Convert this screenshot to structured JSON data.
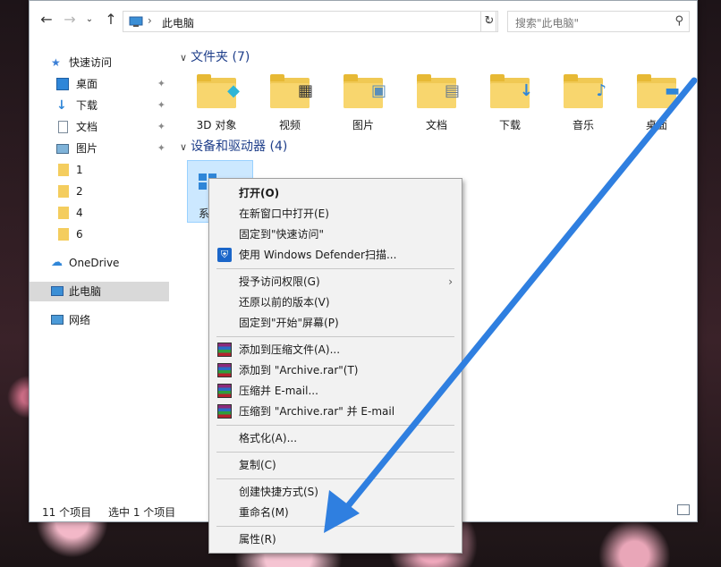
{
  "address": {
    "path": "此电脑",
    "search_placeholder": "搜索\"此电脑\""
  },
  "sidebar": {
    "items": [
      {
        "label": "快速访问",
        "icon": "star-icon",
        "pinned": false
      },
      {
        "label": "桌面",
        "icon": "desktop-icon",
        "pinned": true
      },
      {
        "label": "下载",
        "icon": "download-icon",
        "pinned": true
      },
      {
        "label": "文档",
        "icon": "document-icon",
        "pinned": true
      },
      {
        "label": "图片",
        "icon": "picture-icon",
        "pinned": true
      },
      {
        "label": "1",
        "icon": "folder-icon",
        "pinned": false
      },
      {
        "label": "2",
        "icon": "folder-icon",
        "pinned": false
      },
      {
        "label": "4",
        "icon": "folder-icon",
        "pinned": false
      },
      {
        "label": "6",
        "icon": "folder-icon",
        "pinned": false
      },
      {
        "label": "OneDrive",
        "icon": "cloud-icon",
        "pinned": false
      },
      {
        "label": "此电脑",
        "icon": "computer-icon",
        "pinned": false,
        "selected": true
      },
      {
        "label": "网络",
        "icon": "network-icon",
        "pinned": false
      }
    ]
  },
  "main": {
    "folders_header": "文件夹 (7)",
    "folders": [
      {
        "label": "3D 对象",
        "icon": "3d-objects-icon"
      },
      {
        "label": "视频",
        "icon": "video-icon"
      },
      {
        "label": "图片",
        "icon": "picture-icon"
      },
      {
        "label": "文档",
        "icon": "document-icon"
      },
      {
        "label": "下载",
        "icon": "download-icon"
      },
      {
        "label": "音乐",
        "icon": "music-icon"
      },
      {
        "label": "桌面",
        "icon": "desktop-icon"
      }
    ],
    "devices_header": "设备和驱动器 (4)",
    "drive_label": "系"
  },
  "status": {
    "count": "11 个项目",
    "selected": "选中 1 个项目"
  },
  "context_menu": {
    "items": [
      {
        "label": "打开(O)",
        "bold": true
      },
      {
        "label": "在新窗口中打开(E)"
      },
      {
        "label": "固定到\"快速访问\""
      },
      {
        "label": "使用 Windows Defender扫描...",
        "icon": "defender-shield-icon"
      },
      {
        "label": "授予访问权限(G)",
        "submenu": true
      },
      {
        "label": "还原以前的版本(V)"
      },
      {
        "label": "固定到\"开始\"屏幕(P)"
      },
      {
        "label": "添加到压缩文件(A)...",
        "icon": "winrar-icon"
      },
      {
        "label": "添加到 \"Archive.rar\"(T)",
        "icon": "winrar-icon"
      },
      {
        "label": "压缩并 E-mail...",
        "icon": "winrar-icon"
      },
      {
        "label": "压缩到 \"Archive.rar\" 并 E-mail",
        "icon": "winrar-icon"
      },
      {
        "label": "格式化(A)..."
      },
      {
        "label": "复制(C)"
      },
      {
        "label": "创建快捷方式(S)"
      },
      {
        "label": "重命名(M)"
      },
      {
        "label": "属性(R)"
      }
    ]
  },
  "colors": {
    "accent_arrow": "#2f7fe0",
    "selection": "#cce8ff",
    "header_text": "#1e3e8a"
  }
}
